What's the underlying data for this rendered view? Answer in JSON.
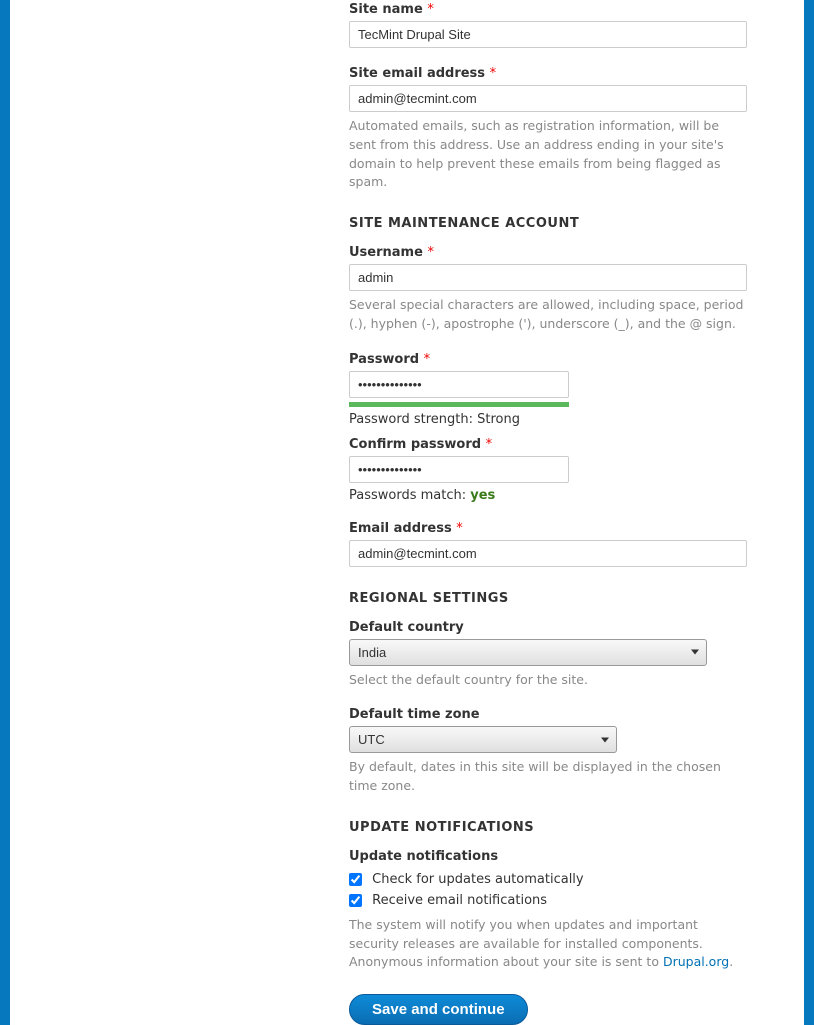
{
  "site_name": {
    "label": "Site name",
    "value": "TecMint Drupal Site"
  },
  "site_email": {
    "label": "Site email address",
    "value": "admin@tecmint.com",
    "description": "Automated emails, such as registration information, will be sent from this address. Use an address ending in your site's domain to help prevent these emails from being flagged as spam."
  },
  "maintenance_heading": "SITE MAINTENANCE ACCOUNT",
  "username": {
    "label": "Username",
    "value": "admin",
    "description": "Several special characters are allowed, including space, period (.), hyphen (-), apostrophe ('), underscore (_), and the @ sign."
  },
  "password": {
    "label": "Password",
    "value": "••••••••••••••",
    "strength_label": "Password strength: ",
    "strength_value": "Strong"
  },
  "confirm_password": {
    "label": "Confirm password",
    "value": "••••••••••••••",
    "match_label": "Passwords match: ",
    "match_value": "yes"
  },
  "account_email": {
    "label": "Email address",
    "value": "admin@tecmint.com"
  },
  "regional_heading": "REGIONAL SETTINGS",
  "default_country": {
    "label": "Default country",
    "value": "India",
    "description": "Select the default country for the site."
  },
  "default_timezone": {
    "label": "Default time zone",
    "value": "UTC",
    "description": "By default, dates in this site will be displayed in the chosen time zone."
  },
  "update_heading": "UPDATE NOTIFICATIONS",
  "update_sub": "Update notifications",
  "check_updates": "Check for updates automatically",
  "receive_email": "Receive email notifications",
  "update_desc_pre": "The system will notify you when updates and important security releases are available for installed components. Anonymous information about your site is sent to ",
  "update_desc_link": "Drupal.org",
  "update_desc_post": ".",
  "submit": "Save and continue"
}
